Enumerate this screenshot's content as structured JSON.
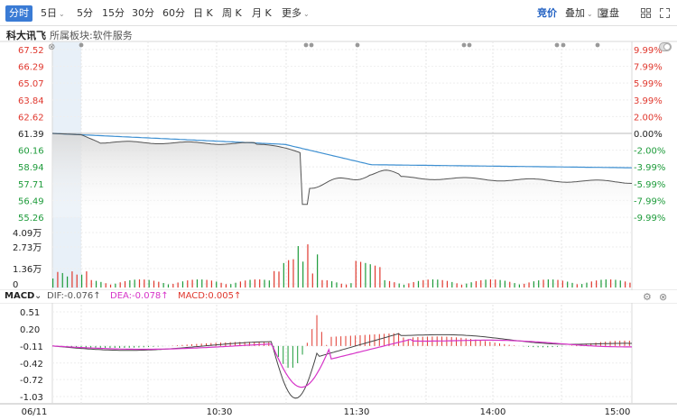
{
  "toolbar": {
    "tabs": [
      "分时",
      "5日",
      "5分",
      "15分",
      "30分",
      "60分",
      "日 K",
      "周 K",
      "月 K",
      "更多"
    ],
    "right_tabs": [
      "竞价",
      "叠加",
      "复盘"
    ]
  },
  "header": {
    "stock_name": "科大讯飞",
    "sector": "所属板块:软件服务"
  },
  "price_axis": {
    "left_labels": [
      "67.52",
      "66.29",
      "65.07",
      "63.84",
      "62.62",
      "61.39",
      "60.16",
      "58.94",
      "57.71",
      "56.49",
      "55.26"
    ],
    "right_labels": [
      "9.99%",
      "7.99%",
      "5.99%",
      "3.99%",
      "2.00%",
      "0.00%",
      "-2.00%",
      "-3.99%",
      "-5.99%",
      "-7.99%",
      "-9.99%"
    ],
    "prev_close": "61.39"
  },
  "volume_axis": {
    "labels": [
      "4.09万",
      "2.73万",
      "1.36万",
      "0"
    ]
  },
  "macd": {
    "title": "MACD",
    "dif": "DIF:-0.076↑",
    "dea": "DEA:-0.078↑",
    "macd": "MACD:0.005↑",
    "labels": [
      "0.51",
      "0.20",
      "-0.11",
      "-0.42",
      "-0.72",
      "-1.03"
    ]
  },
  "time_axis": {
    "labels": [
      "06/11",
      "10:30",
      "11:30",
      "14:00",
      "15:00"
    ]
  },
  "colors": {
    "up": "#e0382e",
    "down": "#1d9b3a",
    "price_line": "#555555",
    "avg_line": "#3d8fd1",
    "dea_line": "#d633c8",
    "accent": "#3a7bd5"
  },
  "chart_data": {
    "type": "line",
    "x": [
      "09:30",
      "10:00",
      "10:30",
      "11:00",
      "11:30",
      "13:30",
      "14:00",
      "14:30",
      "15:00"
    ],
    "series": [
      {
        "name": "price",
        "values": [
          61.39,
          60.9,
          60.8,
          60.0,
          58.9,
          58.3,
          58.2,
          58.1,
          58.0
        ]
      }
    ],
    "ylim": [
      55.26,
      67.52
    ]
  }
}
